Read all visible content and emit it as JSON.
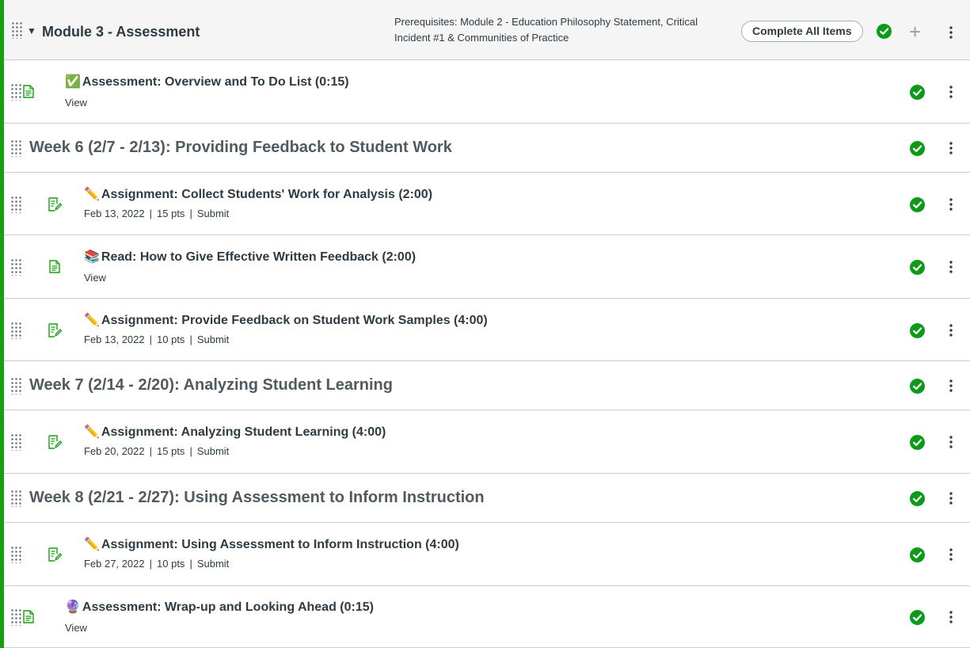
{
  "module": {
    "title": "Module 3 - Assessment",
    "prerequisites": "Prerequisites: Module 2 - Education Philosophy Statement, Critical Incident #1 & Communities of Practice",
    "complete_button": "Complete All Items",
    "add_icon": "plus-icon",
    "accent": "#16a10f",
    "check_color": "#0b9b19"
  },
  "rows": [
    {
      "kind": "page",
      "emoji": "✅",
      "title": "Assessment: Overview and To Do List (0:15)",
      "action": "View"
    },
    {
      "kind": "header",
      "title": "Week 6 (2/7 - 2/13): Providing Feedback to Student Work"
    },
    {
      "kind": "assignment",
      "emoji": "✏️",
      "title": "Assignment: Collect Students' Work for Analysis (2:00)",
      "date": "Feb 13, 2022",
      "pts": "15 pts",
      "action": "Submit"
    },
    {
      "kind": "page",
      "emoji": "📚",
      "title": "Read: How to Give Effective Written Feedback (2:00)",
      "action": "View"
    },
    {
      "kind": "assignment",
      "emoji": "✏️",
      "title": "Assignment: Provide Feedback on Student Work Samples (4:00)",
      "date": "Feb 13, 2022",
      "pts": "10 pts",
      "action": "Submit"
    },
    {
      "kind": "header",
      "title": "Week 7 (2/14 - 2/20): Analyzing Student Learning"
    },
    {
      "kind": "assignment",
      "emoji": "✏️",
      "title": "Assignment: Analyzing Student Learning (4:00)",
      "date": "Feb 20, 2022",
      "pts": "15 pts",
      "action": "Submit"
    },
    {
      "kind": "header",
      "title": "Week 8 (2/21 - 2/27): Using Assessment to Inform Instruction"
    },
    {
      "kind": "assignment",
      "emoji": "✏️",
      "title": "Assignment: Using Assessment to Inform Instruction (4:00)",
      "date": "Feb 27, 2022",
      "pts": "10 pts",
      "action": "Submit"
    },
    {
      "kind": "page",
      "emoji": "🔮",
      "title": "Assessment: Wrap-up and Looking Ahead (0:15)",
      "action": "View"
    }
  ]
}
